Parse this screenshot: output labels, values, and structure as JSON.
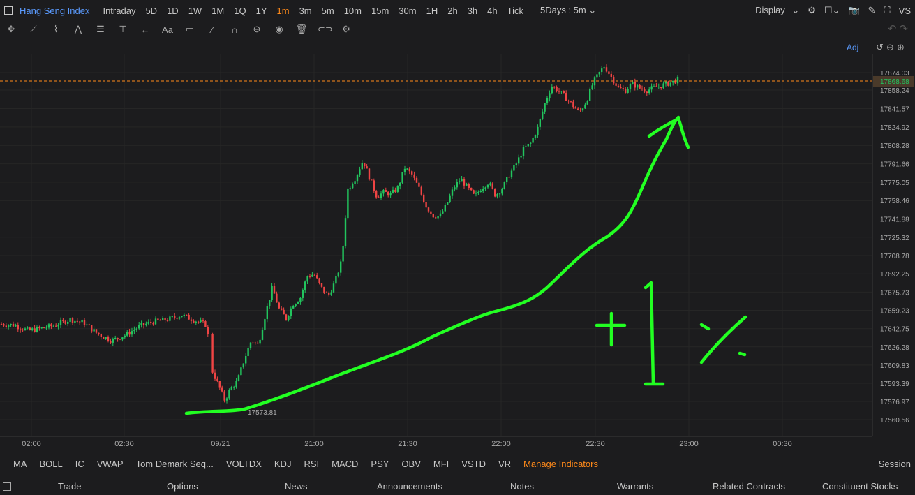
{
  "header": {
    "symbol": "Hang Seng Index",
    "timeframes": [
      "Intraday",
      "5D",
      "1D",
      "1W",
      "1M",
      "1Q",
      "1Y",
      "1m",
      "3m",
      "5m",
      "10m",
      "15m",
      "30m",
      "1H",
      "2h",
      "3h",
      "4h",
      "Tick"
    ],
    "active_timeframe": "1m",
    "range_select": "5Days : 5m",
    "display_label": "Display",
    "vs_label": "VS"
  },
  "chart_panel": {
    "adj_label": "Adj",
    "current_price": "17868.68",
    "low_label": "17573.81",
    "price_ticks": [
      "17874.03",
      "17858.24",
      "17841.57",
      "17824.92",
      "17808.28",
      "17791.66",
      "17775.05",
      "17758.46",
      "17741.88",
      "17725.32",
      "17708.78",
      "17692.25",
      "17675.73",
      "17659.23",
      "17642.75",
      "17626.28",
      "17609.83",
      "17593.39",
      "17576.97",
      "17560.56"
    ],
    "time_ticks": [
      "02:00",
      "02:30",
      "09/21",
      "21:00",
      "21:30",
      "22:00",
      "22:30",
      "23:00",
      "00:30"
    ],
    "annotation_text": "+1 %"
  },
  "chart_data": {
    "type": "candlestick",
    "series": [
      {
        "name": "Hang Seng Index"
      }
    ],
    "y_ticks": [
      17874.03,
      17858.24,
      17841.57,
      17824.92,
      17808.28,
      17791.66,
      17775.05,
      17758.46,
      17741.88,
      17725.32,
      17708.78,
      17692.25,
      17675.73,
      17659.23,
      17642.75,
      17626.28,
      17609.83,
      17593.39,
      17576.97,
      17560.56
    ],
    "x_ticks": [
      "02:00",
      "02:30",
      "09/21",
      "21:00",
      "21:30",
      "22:00",
      "22:30",
      "23:00",
      "00:30"
    ],
    "last_price": 17868.68,
    "session_low": 17573.81,
    "close_path": [
      [
        0,
        17647
      ],
      [
        20,
        17646
      ],
      [
        40,
        17641
      ],
      [
        60,
        17643
      ],
      [
        80,
        17646
      ],
      [
        100,
        17651
      ],
      [
        120,
        17648
      ],
      [
        140,
        17638
      ],
      [
        160,
        17632
      ],
      [
        180,
        17637
      ],
      [
        200,
        17645
      ],
      [
        220,
        17649
      ],
      [
        240,
        17651
      ],
      [
        260,
        17655
      ],
      [
        280,
        17650
      ],
      [
        296,
        17646
      ],
      [
        304,
        17605
      ],
      [
        314,
        17590
      ],
      [
        322,
        17578
      ],
      [
        330,
        17588
      ],
      [
        340,
        17595
      ],
      [
        350,
        17615
      ],
      [
        360,
        17632
      ],
      [
        370,
        17628
      ],
      [
        380,
        17655
      ],
      [
        390,
        17680
      ],
      [
        400,
        17660
      ],
      [
        410,
        17652
      ],
      [
        420,
        17665
      ],
      [
        430,
        17670
      ],
      [
        440,
        17690
      ],
      [
        450,
        17692
      ],
      [
        460,
        17680
      ],
      [
        470,
        17672
      ],
      [
        480,
        17685
      ],
      [
        490,
        17705
      ],
      [
        498,
        17768
      ],
      [
        510,
        17780
      ],
      [
        520,
        17795
      ],
      [
        530,
        17778
      ],
      [
        540,
        17762
      ],
      [
        550,
        17766
      ],
      [
        560,
        17764
      ],
      [
        570,
        17770
      ],
      [
        580,
        17788
      ],
      [
        590,
        17782
      ],
      [
        600,
        17770
      ],
      [
        610,
        17754
      ],
      [
        620,
        17745
      ],
      [
        630,
        17744
      ],
      [
        640,
        17755
      ],
      [
        650,
        17770
      ],
      [
        660,
        17778
      ],
      [
        670,
        17770
      ],
      [
        680,
        17762
      ],
      [
        690,
        17770
      ],
      [
        700,
        17775
      ],
      [
        710,
        17763
      ],
      [
        720,
        17770
      ],
      [
        730,
        17782
      ],
      [
        740,
        17792
      ],
      [
        750,
        17805
      ],
      [
        760,
        17810
      ],
      [
        770,
        17823
      ],
      [
        780,
        17845
      ],
      [
        790,
        17862
      ],
      [
        800,
        17858
      ],
      [
        810,
        17852
      ],
      [
        820,
        17845
      ],
      [
        830,
        17838
      ],
      [
        840,
        17848
      ],
      [
        850,
        17865
      ],
      [
        860,
        17875
      ],
      [
        866,
        17880
      ],
      [
        876,
        17870
      ],
      [
        886,
        17860
      ],
      [
        896,
        17858
      ],
      [
        906,
        17864
      ],
      [
        916,
        17860
      ],
      [
        926,
        17858
      ],
      [
        936,
        17860
      ],
      [
        946,
        17862
      ],
      [
        956,
        17864
      ],
      [
        966,
        17866
      ],
      [
        973,
        17868.68
      ]
    ]
  },
  "indicators": {
    "items": [
      "MA",
      "BOLL",
      "IC",
      "VWAP",
      "Tom Demark Seq...",
      "VOLTDX",
      "KDJ",
      "RSI",
      "MACD",
      "PSY",
      "OBV",
      "MFI",
      "VSTD",
      "VR"
    ],
    "manage_label": "Manage Indicators",
    "session_label": "Session"
  },
  "bottom_tabs": [
    "Trade",
    "Options",
    "News",
    "Announcements",
    "Notes",
    "Warrants",
    "Related Contracts",
    "Constituent Stocks"
  ],
  "colors": {
    "up": "#22c55e",
    "down": "#ef4444",
    "accent": "#ff8a1a",
    "link": "#5b9bff",
    "annotation": "#22ff22"
  }
}
